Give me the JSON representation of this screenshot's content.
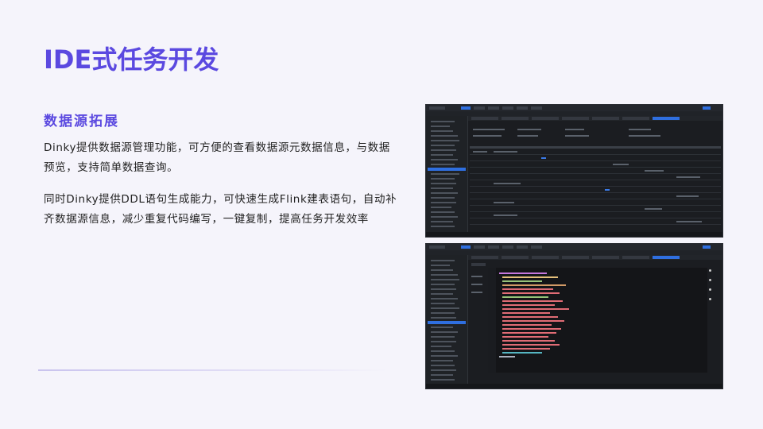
{
  "slide": {
    "title": "IDE式任务开发",
    "section_title": "数据源拓展",
    "paragraph_1": "Dinky提供数据源管理功能，可方便的查看数据源元数据信息，与数据预览，支持简单数据查询。",
    "paragraph_2": "同时Dinky提供DDL语句生成能力，可快速生成Flink建表语句，自动补齐数据源信息，减少重复代码编写，一键复制，提高任务开发效率"
  },
  "screenshots": {
    "top": {
      "description_icon": "metadata-table-screenshot"
    },
    "bottom": {
      "description_icon": "ddl-code-screenshot"
    }
  },
  "colors": {
    "accent": "#5b49e0",
    "background": "#f5f4fb",
    "text": "#222222",
    "ide_bg": "#1b1d21",
    "ide_blue": "#2f6fe0"
  }
}
